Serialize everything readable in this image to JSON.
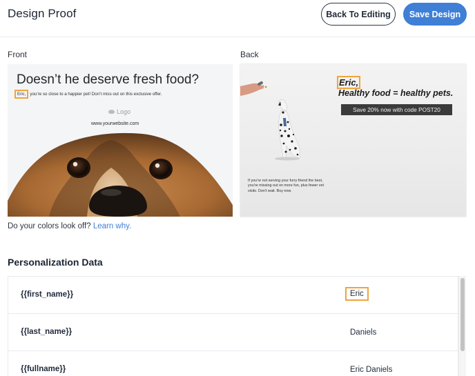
{
  "header": {
    "title": "Design Proof",
    "back_button": "Back To Editing",
    "save_button": "Save Design"
  },
  "front": {
    "label": "Front",
    "headline": "Doesn’t he deserve fresh food?",
    "name": "Eric,",
    "subline": "you’re so close to a happier pet! Don’t miss out on this exclusive offer.",
    "logo_text": "Logo",
    "website": "www.yourwebsite.com"
  },
  "back": {
    "label": "Back",
    "name": "Eric,",
    "tagline": "Healthy food = healthy pets.",
    "promo": "Save 20% now with code POST20",
    "body": "If you’re not serving your furry friend the best, you’re missing out on more fun, plus fewer vet visits. Don’t wait. Buy now."
  },
  "colors_notice": {
    "text": "Do your colors look off?",
    "link": "Learn why."
  },
  "personalization": {
    "title": "Personalization Data",
    "rows": [
      {
        "key": "{{first_name}}",
        "value": "Eric"
      },
      {
        "key": "{{last_name}}",
        "value": "Daniels"
      },
      {
        "key": "{{fullname}}",
        "value": "Eric Daniels"
      }
    ]
  },
  "colors": {
    "accent": "#3f7fd6",
    "highlight": "#f0a33c"
  }
}
